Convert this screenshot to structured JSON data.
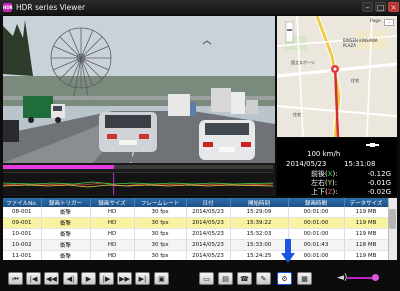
{
  "window": {
    "title": "HDR series Viewer",
    "icon_text": "HDR"
  },
  "map": {
    "top_label": "Page",
    "labels": [
      "BINSEN KINSAWA PLAZA",
      "国立スポーツ",
      "住宅",
      "住宅"
    ],
    "zoom_out": "-"
  },
  "telemetry": {
    "speed": "100 km/h",
    "date": "2014/05/23",
    "time": "15:31:08",
    "gsensor": [
      {
        "label": "前後(",
        "axis": "X",
        "close": "):",
        "value": "-0.12G",
        "color": "#3bd14a"
      },
      {
        "label": "左右(",
        "axis": "Y",
        "close": "):",
        "value": "-0.01G",
        "color": "#e8d83c"
      },
      {
        "label": "上下(",
        "axis": "Z",
        "close": "):",
        "value": "-0.02G",
        "color": "#e04040"
      }
    ]
  },
  "playback": {
    "progress": 0.41
  },
  "table": {
    "headers": [
      "ファイルNo.",
      "録画トリガー",
      "録画サイズ",
      "フレームレート",
      "日付",
      "開始時刻",
      "録画時間",
      "データサイズ"
    ],
    "rows": [
      [
        "08-001",
        "衝撃",
        "HD",
        "30 fps",
        "2014/05/23",
        "15:29:09",
        "00:01:00",
        "119 MB"
      ],
      [
        "09-001",
        "衝撃",
        "HD",
        "30 fps",
        "2014/05/23",
        "15:39:22",
        "00:01:00",
        "119 MB"
      ],
      [
        "10-001",
        "衝撃",
        "HD",
        "30 fps",
        "2014/05/23",
        "15:32:03",
        "00:01:00",
        "119 MB"
      ],
      [
        "10-002",
        "衝撃",
        "HD",
        "30 fps",
        "2014/05/23",
        "15:33:00",
        "00:01:43",
        "118 MB"
      ],
      [
        "11-001",
        "衝撃",
        "HD",
        "30 fps",
        "2014/05/23",
        "15:24:25",
        "00:01:00",
        "119 MB"
      ]
    ],
    "selected_row": 1
  },
  "controls": [
    {
      "name": "skip-to-start-button",
      "glyph": "⏮"
    },
    {
      "name": "previous-file-button",
      "glyph": "|◀"
    },
    {
      "name": "rewind-button",
      "glyph": "◀◀"
    },
    {
      "name": "step-back-button",
      "glyph": "◀|"
    },
    {
      "name": "play-button",
      "glyph": "▶"
    },
    {
      "name": "step-forward-button",
      "glyph": "|▶"
    },
    {
      "name": "fast-forward-button",
      "glyph": "▶▶"
    },
    {
      "name": "next-file-button",
      "glyph": "▶|"
    },
    {
      "name": "snapshot-button",
      "glyph": "▣"
    },
    {
      "name": "open-folder-button",
      "glyph": "▭"
    },
    {
      "name": "save-button",
      "glyph": "▤"
    },
    {
      "name": "phone-button",
      "glyph": "☎"
    },
    {
      "name": "tools-button",
      "glyph": "✎"
    },
    {
      "name": "settings-button",
      "glyph": "⚙"
    },
    {
      "name": "print-button",
      "glyph": "▦"
    }
  ],
  "active_control": "settings-button",
  "volume": {
    "level": 0.95,
    "icon": "◄)"
  },
  "colors": {
    "accent_magenta": "#e23be0",
    "table_header": "#2f6fae",
    "selected_row": "#f7f3a0",
    "highlight_arrow": "#1a55e0"
  }
}
